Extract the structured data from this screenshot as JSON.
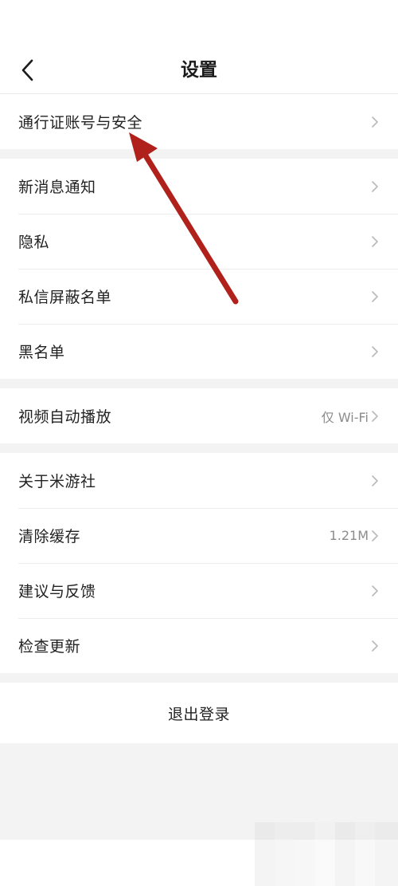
{
  "header": {
    "title": "设置"
  },
  "groups": [
    {
      "items": [
        {
          "label": "通行证账号与安全"
        }
      ]
    },
    {
      "items": [
        {
          "label": "新消息通知"
        },
        {
          "label": "隐私"
        },
        {
          "label": "私信屏蔽名单"
        },
        {
          "label": "黑名单"
        }
      ]
    },
    {
      "items": [
        {
          "label": "视频自动播放",
          "value": "仅 Wi-Fi"
        }
      ]
    },
    {
      "items": [
        {
          "label": "关于米游社"
        },
        {
          "label": "清除缓存",
          "value": "1.21M"
        },
        {
          "label": "建议与反馈"
        },
        {
          "label": "检查更新"
        }
      ]
    }
  ],
  "footer": {
    "logout_label": "退出登录"
  },
  "colors": {
    "annotation_arrow": "#b1211c",
    "chevron": "#b9b9b9"
  },
  "icons": {
    "back": "chevron-left-icon",
    "row": "chevron-right-icon"
  }
}
